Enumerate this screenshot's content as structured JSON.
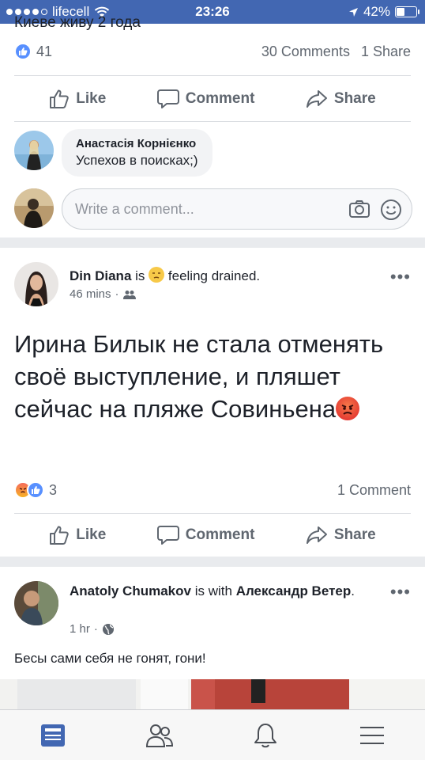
{
  "status_bar": {
    "carrier": "lifecell",
    "time": "23:26",
    "battery": "42%",
    "battery_level": 0.42
  },
  "post1": {
    "cut_text": "Киеве живу 2 года",
    "like_count": "41",
    "comments": "30 Comments",
    "shares": "1 Share",
    "actions": {
      "like": "Like",
      "comment": "Comment",
      "share": "Share"
    },
    "comment": {
      "author": "Анастасія Корнієнко",
      "text": "Успехов в поисках;)"
    },
    "write_placeholder": "Write a comment..."
  },
  "post2": {
    "author": "Din Diana",
    "is": "is",
    "feeling": "feeling drained.",
    "time": "46 mins",
    "body": "Ирина Билык не стала отменять своё выступление, и пляшет сейчас на пляже Совиньена",
    "reaction_count": "3",
    "comments": "1 Comment",
    "actions": {
      "like": "Like",
      "comment": "Comment",
      "share": "Share"
    }
  },
  "post3": {
    "author": "Anatoly Chumakov",
    "with_text": "is with",
    "tagged": "Александр Ветер",
    "period": ".",
    "time": "1 hr",
    "body": "Бесы сами себя не гонят, гони!"
  },
  "tab_bar": {
    "tabs": [
      "news-feed-icon",
      "friends-icon",
      "notifications-icon",
      "menu-icon"
    ],
    "active_color": "#4267b2",
    "inactive_color": "#4b4f56"
  }
}
